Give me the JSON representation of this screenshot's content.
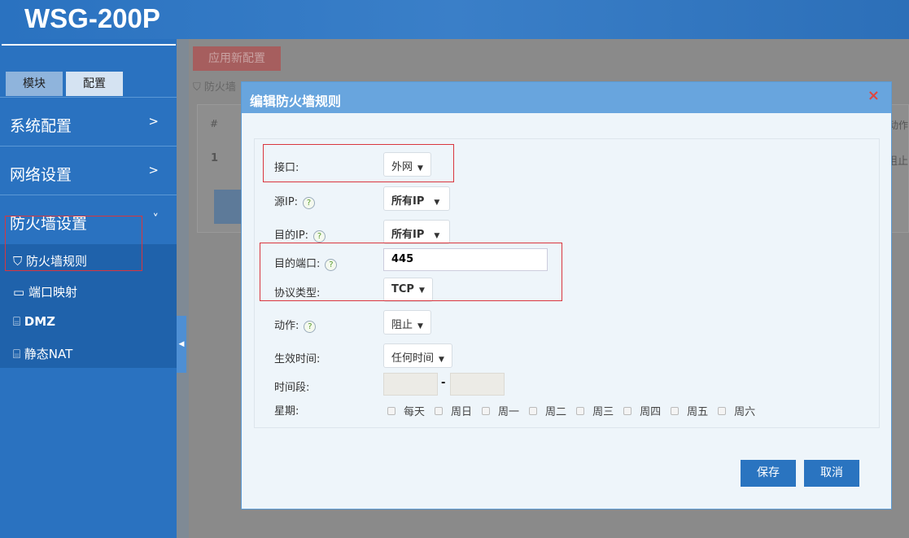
{
  "app": {
    "title": "WSG-200P"
  },
  "sidebar": {
    "tabs": [
      {
        "label": "模块"
      },
      {
        "label": "配置"
      }
    ],
    "menus": [
      {
        "label": "系统配置",
        "chevron": ">"
      },
      {
        "label": "网络设置",
        "chevron": ">"
      },
      {
        "label": "防火墙设置",
        "chevron": "˅"
      }
    ],
    "subitems": [
      {
        "label": "防火墙规则",
        "icon": "shield-icon"
      },
      {
        "label": "端口映射",
        "icon": "monitor-icon"
      },
      {
        "label": "DMZ",
        "icon": "router-icon"
      },
      {
        "label": "静态NAT",
        "icon": "router-icon"
      }
    ]
  },
  "background": {
    "apply_label": "应用新配置",
    "breadcrumb": "防火墙",
    "table_header_num": "#",
    "table_header_action": "动作",
    "row_num": "1",
    "row_action": "阻止"
  },
  "modal": {
    "title": "编辑防火墙规则",
    "close": "×",
    "fields": {
      "interface": {
        "label": "接口:",
        "value": "外网"
      },
      "src_ip": {
        "label": "源IP:",
        "value": "所有IP"
      },
      "dst_ip": {
        "label": "目的IP:",
        "value": "所有IP"
      },
      "dst_port": {
        "label": "目的端口:",
        "value": "445"
      },
      "protocol": {
        "label": "协议类型:",
        "value": "TCP"
      },
      "action": {
        "label": "动作:",
        "value": "阻止"
      },
      "effective_time": {
        "label": "生效时间:",
        "value": "任何时间"
      },
      "time_range": {
        "label": "时间段:",
        "separator": "-"
      },
      "weekday": {
        "label": "星期:",
        "days": [
          "每天",
          "周日",
          "周一",
          "周二",
          "周三",
          "周四",
          "周五",
          "周六"
        ]
      }
    },
    "help": "?",
    "save": "保存",
    "cancel": "取消"
  },
  "colors": {
    "sidebar": "#2a72c0",
    "modal_header": "#68a5de",
    "button": "#2a74c0",
    "highlight": "#d9363e"
  }
}
